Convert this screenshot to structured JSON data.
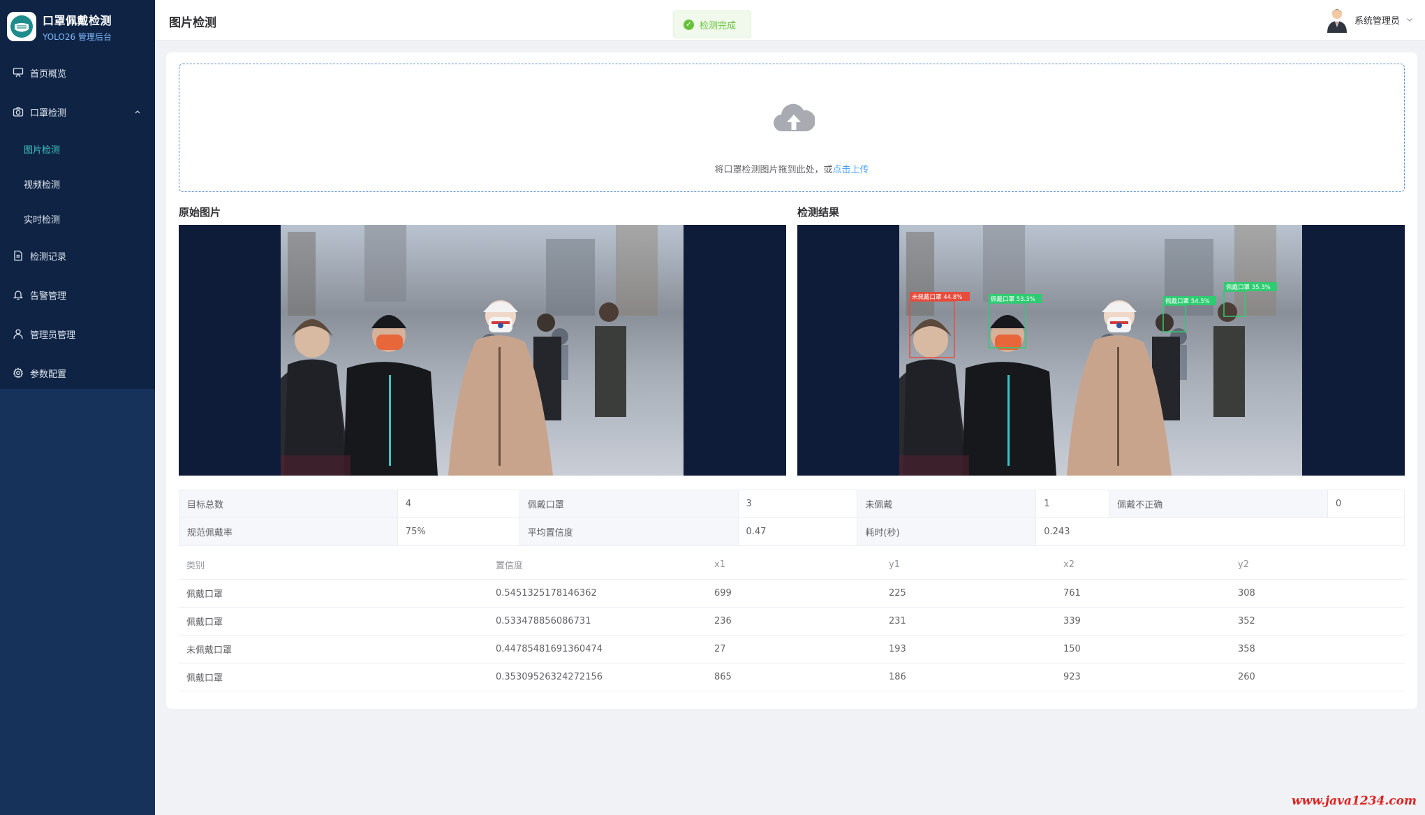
{
  "brand": {
    "title": "口罩佩戴检测",
    "subtitle": "YOLO26 管理后台"
  },
  "sidebar": {
    "items": [
      {
        "label": "首页概览",
        "icon": "dashboard-icon"
      },
      {
        "label": "口罩检测",
        "icon": "camera-icon",
        "expanded": true
      },
      {
        "label": "检测记录",
        "icon": "document-icon"
      },
      {
        "label": "告警管理",
        "icon": "bell-icon"
      },
      {
        "label": "管理员管理",
        "icon": "user-icon"
      },
      {
        "label": "参数配置",
        "icon": "gear-icon"
      }
    ],
    "subitems": [
      {
        "label": "图片检测",
        "active": true
      },
      {
        "label": "视频检测"
      },
      {
        "label": "实时检测"
      }
    ]
  },
  "header": {
    "title": "图片检测",
    "toast": "检测完成",
    "user": "系统管理员"
  },
  "upload": {
    "hint": "将口罩检测图片拖到此处，或",
    "link": "点击上传"
  },
  "images": {
    "original_title": "原始图片",
    "result_title": "检测结果"
  },
  "result_boxes": [
    {
      "label": "未佩戴口罩 44.8%",
      "color": "#e74c3c"
    },
    {
      "label": "佩戴口罩 53.3%",
      "color": "#2ecc71"
    },
    {
      "label": "佩戴口罩 54.5%",
      "color": "#2ecc71"
    },
    {
      "label": "佩戴口罩 35.3%",
      "color": "#2ecc71"
    }
  ],
  "stats": {
    "total_label": "目标总数",
    "total": "4",
    "masked_label": "佩戴口罩",
    "masked": "3",
    "unmasked_label": "未佩戴",
    "unmasked": "1",
    "incorrect_label": "佩戴不正确",
    "incorrect": "0",
    "rate_label": "规范佩戴率",
    "rate": "75%",
    "avgconf_label": "平均置信度",
    "avgconf": "0.47",
    "time_label": "耗时(秒)",
    "time": "0.243"
  },
  "detections": {
    "columns": [
      "类别",
      "置信度",
      "x1",
      "y1",
      "x2",
      "y2"
    ],
    "rows": [
      [
        "佩戴口罩",
        "0.5451325178146362",
        "699",
        "225",
        "761",
        "308"
      ],
      [
        "佩戴口罩",
        "0.533478856086731",
        "236",
        "231",
        "339",
        "352"
      ],
      [
        "未佩戴口罩",
        "0.44785481691360474",
        "27",
        "193",
        "150",
        "358"
      ],
      [
        "佩戴口罩",
        "0.35309526324272156",
        "865",
        "186",
        "923",
        "260"
      ]
    ]
  },
  "watermark": "www.java1234.com",
  "colors": {
    "sidebar": "#17325a",
    "sidebar_top": "#0f2444",
    "accent": "#3ec2c2",
    "success": "#67c23a",
    "link": "#409eff"
  }
}
